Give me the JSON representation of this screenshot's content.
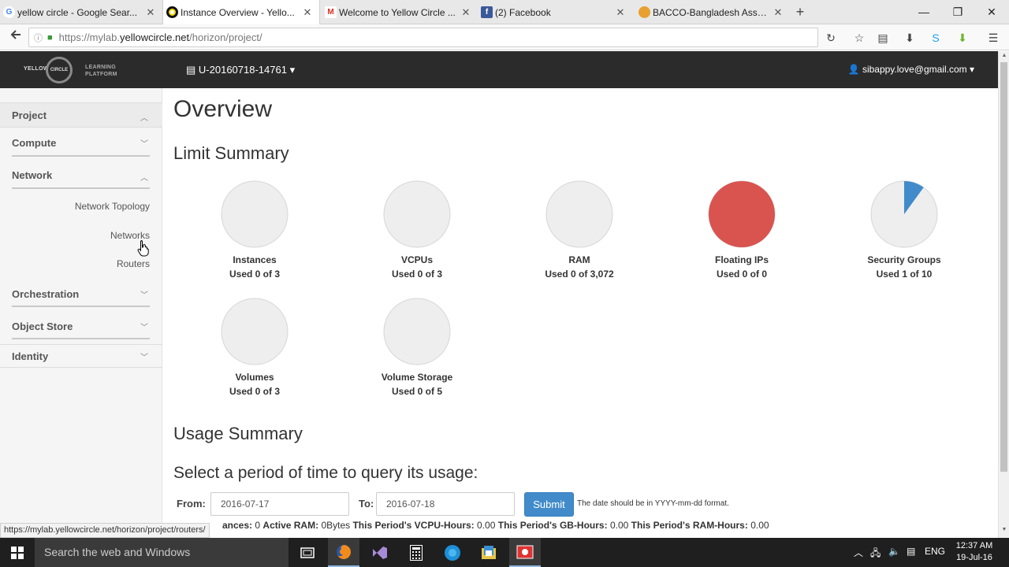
{
  "browser": {
    "tabs": [
      {
        "label": "yellow circle - Google Sear...",
        "favicon": "google-icon",
        "active": false
      },
      {
        "label": "Instance Overview - Yello...",
        "favicon": "yellowcircle-icon",
        "active": true
      },
      {
        "label": "Welcome to Yellow Circle ...",
        "favicon": "gmail-icon",
        "active": false
      },
      {
        "label": "(2) Facebook",
        "favicon": "facebook-icon",
        "active": false
      },
      {
        "label": "BACCO-Bangladesh Asso...",
        "favicon": "bacco-icon",
        "active": false
      }
    ],
    "url_prefix": "https://mylab.",
    "url_domain": "yellowcircle.net",
    "url_path": "/horizon/project/",
    "status_url": "https://mylab.yellowcircle.net/horizon/project/routers/"
  },
  "header": {
    "logo_left": "YELLOW",
    "logo_circle": "CIRCLE",
    "logo_right_1": "LEARNING",
    "logo_right_2": "PLATFORM",
    "project": "U-20160718-14761",
    "user": "sibappy.love@gmail.com"
  },
  "sidebar": {
    "project": "Project",
    "compute": "Compute",
    "network": "Network",
    "network_items": [
      "Network Topology",
      "Networks",
      "Routers"
    ],
    "orchestration": "Orchestration",
    "object_store": "Object Store",
    "identity": "Identity"
  },
  "main": {
    "title": "Overview",
    "limit_summary": "Limit Summary",
    "usage_summary": "Usage Summary",
    "query_title": "Select a period of time to query its usage:",
    "from_label": "From:",
    "from_value": "2016-07-17",
    "to_label": "To:",
    "to_value": "2016-07-18",
    "submit": "Submit",
    "date_hint": "The date should be in YYYY-mm-dd format.",
    "stats": {
      "instances_label": "ances:",
      "instances_value": "0",
      "ram_label": "Active RAM:",
      "ram_value": "0Bytes",
      "vcpu_label": "This Period's VCPU-Hours:",
      "vcpu_value": "0.00",
      "gb_label": "This Period's GB-Hours:",
      "gb_value": "0.00",
      "ramh_label": "This Period's RAM-Hours:",
      "ramh_value": "0.00"
    }
  },
  "chart_data": {
    "type": "pie",
    "colors": {
      "empty": "#eeeeee",
      "used": "#428bca",
      "full": "#d9534f"
    },
    "items": [
      {
        "name": "Instances",
        "used_text": "Used 0 of 3",
        "used": 0,
        "total": 3
      },
      {
        "name": "VCPUs",
        "used_text": "Used 0 of 3",
        "used": 0,
        "total": 3
      },
      {
        "name": "RAM",
        "used_text": "Used 0 of 3,072",
        "used": 0,
        "total": 3072
      },
      {
        "name": "Floating IPs",
        "used_text": "Used 0 of 0",
        "used": 0,
        "total": 0
      },
      {
        "name": "Security Groups",
        "used_text": "Used 1 of 10",
        "used": 1,
        "total": 10
      },
      {
        "name": "Volumes",
        "used_text": "Used 0 of 3",
        "used": 0,
        "total": 3
      },
      {
        "name": "Volume Storage",
        "used_text": "Used 0 of 5",
        "used": 0,
        "total": 5
      }
    ]
  },
  "taskbar": {
    "search_placeholder": "Search the web and Windows",
    "language": "ENG",
    "time": "12:37 AM",
    "date": "19-Jul-16"
  }
}
